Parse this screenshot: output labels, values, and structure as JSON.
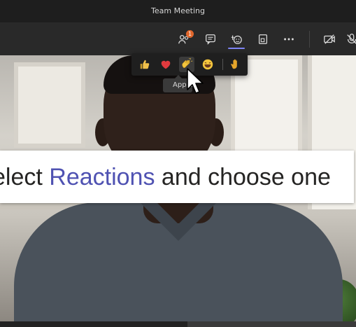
{
  "window": {
    "title": "Team Meeting"
  },
  "toolbar": {
    "participants_badge": "1",
    "buttons": [
      {
        "name": "participants-icon"
      },
      {
        "name": "chat-icon"
      },
      {
        "name": "reactions-icon"
      },
      {
        "name": "rooms-icon"
      },
      {
        "name": "more-icon"
      },
      {
        "name": "camera-off-icon"
      },
      {
        "name": "mic-off-icon"
      }
    ]
  },
  "reactions": {
    "items": [
      {
        "name": "like-reaction",
        "glyph": "👍"
      },
      {
        "name": "heart-reaction",
        "glyph": "❤"
      },
      {
        "name": "applause-reaction",
        "glyph": "👏"
      },
      {
        "name": "laugh-reaction",
        "glyph": "😆"
      },
      {
        "name": "raise-hand-reaction",
        "glyph": "✋"
      }
    ],
    "tooltip": "Applause"
  },
  "caption": {
    "prefix": "elect ",
    "highlight": "Reactions",
    "suffix": " and choose one"
  },
  "colors": {
    "accent": "#7f85f5",
    "highlight_text": "#4f52b2",
    "badge": "#e0662c"
  }
}
